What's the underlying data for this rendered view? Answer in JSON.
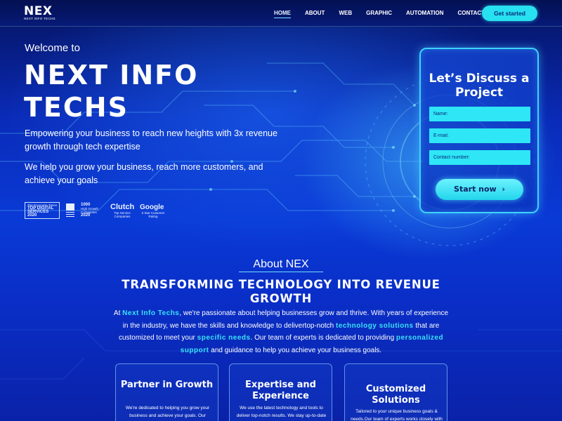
{
  "header": {
    "logo": "NEX",
    "logo_subtitle": "NEXT INFO TECHS",
    "nav": [
      "HOME",
      "ABOUT",
      "WEB",
      "GRAPHIC",
      "AUTOMATION",
      "CONTACT"
    ],
    "active_nav": "HOME",
    "cta": "Get started"
  },
  "hero": {
    "welcome": "Welcome to",
    "title": "NEXT INFO TECHS",
    "paragraph1": "Empowering your business to reach new heights with 3x revenue growth through tech expertise",
    "paragraph2": "We help you grow your business, reach more customers, and achieve your goals",
    "badges": [
      {
        "line1": "The Economic Times",
        "line2": "TOP DIGITAL",
        "line3": "SERVICES",
        "year": "2020"
      },
      {
        "line1": "",
        "line2": "",
        "line3": "",
        "year": ""
      },
      {
        "big": "1000",
        "line1": "High Growth",
        "line2": "Companies",
        "year": "2020"
      },
      {
        "big": "Clutch",
        "line1": "Top Service",
        "line2": "Companies"
      },
      {
        "big": "Google",
        "line1": "5 Star Customer",
        "line2": "Rating"
      }
    ]
  },
  "form": {
    "title": "Let’s Discuss a Project",
    "name_placeholder": "Name:",
    "email_placeholder": "E-mail:",
    "contact_placeholder": "Contact number:",
    "submit": "Start now"
  },
  "about": {
    "heading": "About NEX",
    "title": "TRANSFORMING TECHNOLOGY INTO REVENUE GROWTH",
    "text_parts": {
      "p1": "At ",
      "h1": "Next Info Techs",
      "p2": ", we're passionate about helping businesses grow and thrive. With years of experience in the industry, we have the skills and knowledge to delivertop-notch ",
      "h2": "technology solutions",
      "p3": " that are customized to meet your ",
      "h3": "specific needs",
      "p4": ". Our team of experts is dedicated to providing ",
      "h4": "personalized support",
      "p5": " and guidance to help you achieve your business goals."
    }
  },
  "cards": [
    {
      "title": "Partner in Growth",
      "text": "We're dedicated to helping you grow your business and achieve your goals. Our"
    },
    {
      "title": "Expertise and Experience",
      "text": "We use the latest technology and tools to deliver top-notch results. We stay up-to-date"
    },
    {
      "title": "Customized Solutions",
      "text": "Tailored to your unique business goals & needs.Our team of experts works closely with"
    }
  ],
  "colors": {
    "accent_cyan": "#2ee6f6",
    "background_blue": "#0a3ad6",
    "highlight_text": "#38e4f5"
  }
}
